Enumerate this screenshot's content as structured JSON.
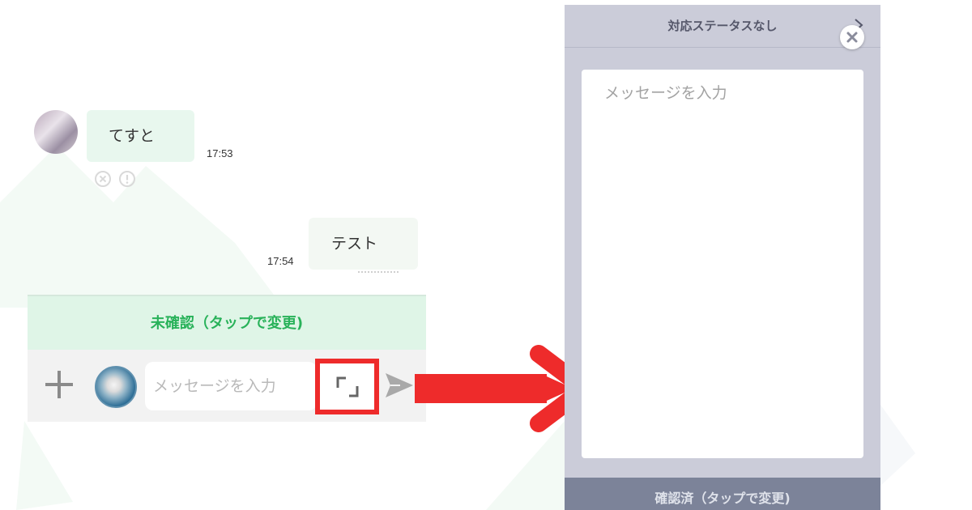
{
  "chat": {
    "incoming": {
      "text": "てすと",
      "time": "17:53"
    },
    "outgoing": {
      "text": "テスト",
      "time": "17:54"
    },
    "status_label": "未確認（タップで変更)",
    "input_placeholder": "メッセージを入力"
  },
  "panel": {
    "status_title": "対応ステータスなし",
    "input_placeholder": "メッセージを入力",
    "footer_label": "確認済（タップで変更)"
  },
  "colors": {
    "status_green": "#29b25a",
    "highlight_red": "#ee2b2b",
    "panel_bg": "#cbccd9",
    "footer_bg": "#7c8399"
  }
}
